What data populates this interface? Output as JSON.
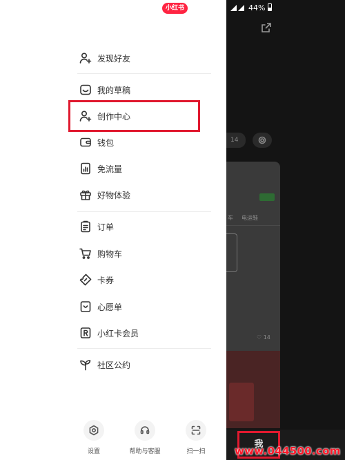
{
  "drawer": {
    "badge": "小红书",
    "groups": [
      [
        {
          "label": "发现好友",
          "icon": "add-friend-icon"
        }
      ],
      [
        {
          "label": "我的草稿",
          "icon": "drafts-icon"
        },
        {
          "label": "创作中心",
          "icon": "creator-center-icon"
        },
        {
          "label": "钱包",
          "icon": "wallet-icon"
        },
        {
          "label": "免流量",
          "icon": "free-data-icon"
        },
        {
          "label": "好物体验",
          "icon": "gift-icon"
        }
      ],
      [
        {
          "label": "订单",
          "icon": "order-icon"
        },
        {
          "label": "购物车",
          "icon": "cart-icon"
        },
        {
          "label": "卡券",
          "icon": "coupon-icon"
        },
        {
          "label": "心愿单",
          "icon": "wishlist-icon"
        },
        {
          "label": "小红卡会员",
          "icon": "membership-card-icon"
        }
      ],
      [
        {
          "label": "社区公约",
          "icon": "sprout-icon"
        }
      ]
    ],
    "bottom": [
      {
        "label": "设置",
        "icon": "settings-icon"
      },
      {
        "label": "帮助与客服",
        "icon": "headset-icon"
      },
      {
        "label": "扫一扫",
        "icon": "scan-icon"
      }
    ]
  },
  "status_bar": {
    "battery": "44%"
  },
  "background": {
    "tab_me": "我",
    "snippets": [
      "车",
      "电运鞋",
      "14"
    ]
  },
  "watermark": "www.044500.com",
  "colors": {
    "accent": "#ff2442",
    "highlight": "#e0192f"
  }
}
